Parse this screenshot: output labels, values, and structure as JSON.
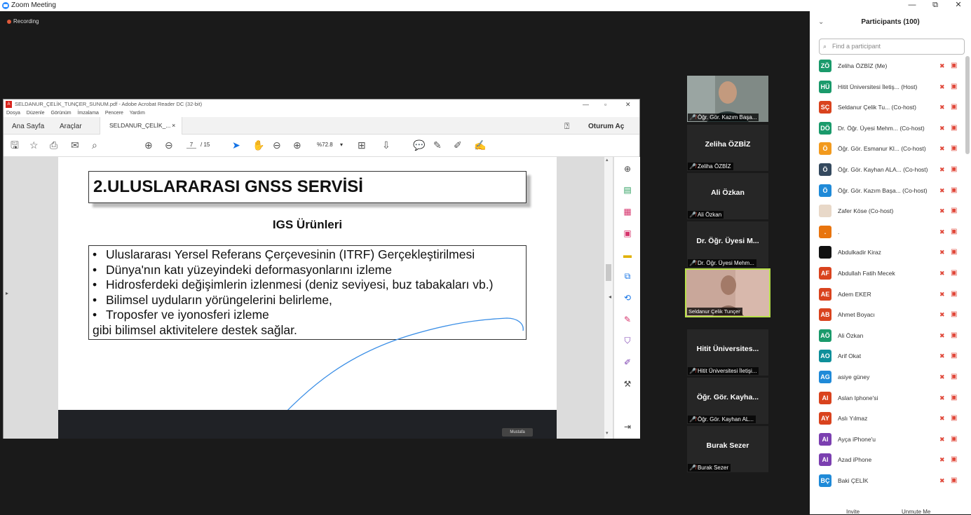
{
  "window": {
    "title": "Zoom Meeting",
    "minimize": "—",
    "restore": "⧉",
    "close": "✕"
  },
  "recording": "Recording",
  "acrobat": {
    "title": "SELDANUR_ÇELİK_TUNÇER_SUNUM.pdf - Adobe Acrobat Reader DC (32-bit)",
    "menu": [
      "Dosya",
      "Düzenle",
      "Görünüm",
      "İmzalama",
      "Pencere",
      "Yardım"
    ],
    "tab_home": "Ana Sayfa",
    "tab_tools": "Araçlar",
    "tab_doc": "SELDANUR_ÇELİK_...",
    "signin": "Oturum Aç",
    "page_current": "7",
    "page_total": "/ 15",
    "zoom": "%72.8",
    "presenter_label": "Mustafa"
  },
  "slide": {
    "title": "2.ULUSLARARASI GNSS SERVİSİ",
    "subtitle": "IGS Ürünleri",
    "bullets": [
      "Uluslararası Yersel Referans Çerçevesinin (ITRF) Gerçekleştirilmesi",
      "Dünya'nın katı yüzeyindeki deformasyonlarını izleme",
      "Hidrosferdeki değişimlerin izlenmesi (deniz seviyesi, buz tabakaları vb.)",
      "Bilimsel uyduların yörüngelerini belirleme,",
      "Troposfer ve iyonosferi izleme"
    ],
    "closing": "gibi bilimsel aktivitelere destek sağlar."
  },
  "video_tiles": [
    {
      "name": "",
      "label": "Öğr. Gör. Kazım Başa..."
    },
    {
      "name": "Zeliha ÖZBİZ",
      "label": "Zeliha ÖZBİZ"
    },
    {
      "name": "Ali Özkan",
      "label": "Ali Özkan"
    },
    {
      "name": "Dr. Öğr. Üyesi M...",
      "label": "Dr. Öğr. Üyesi Mehm..."
    },
    {
      "name": "",
      "label": "Seldanur Çelik Tunçer"
    },
    {
      "name": "Hitit Üniversites...",
      "label": "Hitit Üniversitesi İletişi..."
    },
    {
      "name": "Öğr. Gör. Kayha...",
      "label": "Öğr. Gör. Kayhan AL..."
    },
    {
      "name": "Burak Sezer",
      "label": "Burak Sezer"
    }
  ],
  "participants": {
    "header": "Participants (100)",
    "search_placeholder": "Find a participant",
    "list": [
      {
        "initials": "ZÖ",
        "color": "#1a9a6b",
        "name": "Zeliha ÖZBİZ (Me)"
      },
      {
        "initials": "HÜ",
        "color": "#1a9a6b",
        "name": "Hitit Üniversitesi İletiş... (Host)"
      },
      {
        "initials": "SÇ",
        "color": "#d9431e",
        "name": "Seldanur Çelik Tu... (Co-host)"
      },
      {
        "initials": "DÖ",
        "color": "#1a9a6b",
        "name": "Dr. Öğr. Üyesi Mehm... (Co-host)"
      },
      {
        "initials": "Ö",
        "color": "#f29a1e",
        "name": "Öğr. Gör. Esmanur Kl... (Co-host)"
      },
      {
        "initials": "Ö",
        "color": "#34495e",
        "name": "Öğr. Gör. Kayhan ALA... (Co-host)"
      },
      {
        "initials": "Ö",
        "color": "#1f8ad8",
        "name": "Öğr. Gör. Kazım Başa... (Co-host)"
      },
      {
        "initials": "",
        "color": "#e8d8c8",
        "name": "Zafer Köse (Co-host)"
      },
      {
        "initials": ".",
        "color": "#e8740e",
        "name": "."
      },
      {
        "initials": "",
        "color": "#111111",
        "name": "Abdulkadir Kiraz"
      },
      {
        "initials": "AF",
        "color": "#d9431e",
        "name": "Abdullah Fatih Mecek"
      },
      {
        "initials": "AE",
        "color": "#d9431e",
        "name": "Adem EKER"
      },
      {
        "initials": "AB",
        "color": "#d9431e",
        "name": "Ahmet Boyacı"
      },
      {
        "initials": "AÖ",
        "color": "#1a9a6b",
        "name": "Ali Özkan"
      },
      {
        "initials": "AO",
        "color": "#0e8f9a",
        "name": "Arif Okat"
      },
      {
        "initials": "AG",
        "color": "#1f8ad8",
        "name": "asiye güney"
      },
      {
        "initials": "AI",
        "color": "#d9431e",
        "name": "Aslan Iphone'si"
      },
      {
        "initials": "AY",
        "color": "#d9431e",
        "name": "Aslı Yılmaz"
      },
      {
        "initials": "AI",
        "color": "#7b3fb0",
        "name": "Ayça iPhone'u"
      },
      {
        "initials": "AI",
        "color": "#7b3fb0",
        "name": "Azad iPhone"
      },
      {
        "initials": "BÇ",
        "color": "#1f8ad8",
        "name": "Baki ÇELİK"
      }
    ],
    "invite": "Invite",
    "unmute": "Unmute Me"
  }
}
